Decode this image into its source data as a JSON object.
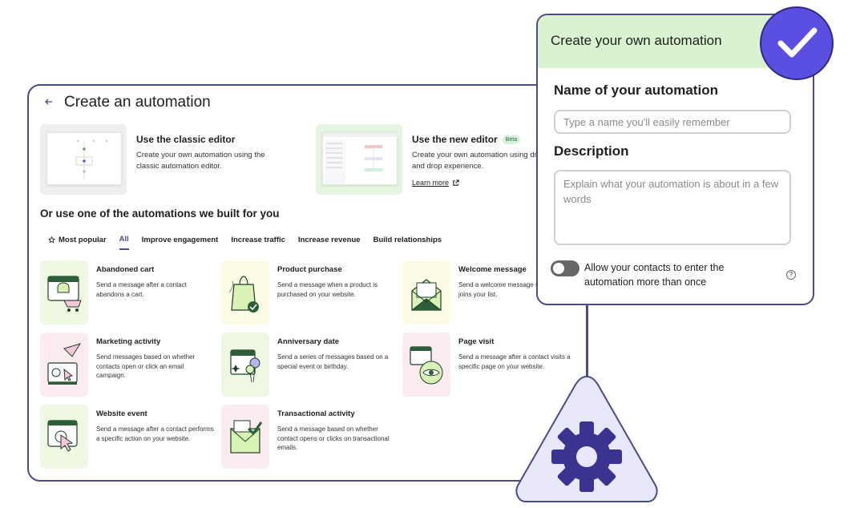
{
  "main": {
    "title": "Create an automation",
    "classic_editor": {
      "title": "Use the classic editor",
      "description": "Create your own automation using the classic automation editor."
    },
    "new_editor": {
      "title": "Use the new editor",
      "badge": "Beta",
      "description": "Create your own automation using drag and drop experience.",
      "learn_more": "Learn more"
    },
    "section_title": "Or use one of the automations we built for you",
    "tabs": [
      {
        "label": "Most popular"
      },
      {
        "label": "All"
      },
      {
        "label": "Improve engagement"
      },
      {
        "label": "Increase traffic"
      },
      {
        "label": "Increase revenue"
      },
      {
        "label": "Build relationships"
      }
    ],
    "active_tab": "All",
    "tiles": [
      {
        "title": "Abandoned cart",
        "description": "Send a message after a contact abandons a cart."
      },
      {
        "title": "Product purchase",
        "description": "Send a message when a product is purchased on your website."
      },
      {
        "title": "Welcome message",
        "description": "Send a welcome message subscriber joins your list."
      },
      {
        "title": "Marketing activity",
        "description": "Send messages based on whether contacts open or click an email campaign."
      },
      {
        "title": "Anniversary date",
        "description": "Send a series of messages based on a special event or birthday."
      },
      {
        "title": "Page visit",
        "description": "Send a message after a contact visits a specific page on your website."
      },
      {
        "title": "Website event",
        "description": "Send a message after a contact performs a specific action on your website."
      },
      {
        "title": "Transactional activity",
        "description": "Send a message based on whether contact opens or clicks on transactional emails."
      }
    ]
  },
  "form": {
    "header": "Create your own automation",
    "name_label": "Name of your automation",
    "name_placeholder": "Type a name you'll easily remember",
    "description_label": "Description",
    "description_placeholder": "Explain what your automation is about in a few words",
    "toggle_label": "Allow your contacts to enter the automation more than once",
    "toggle_on": false
  },
  "colors": {
    "accent": "#4a4a8c",
    "badge_purple": "#5a4fe0",
    "form_header_bg": "#daf2cf",
    "triangle_fill": "#e9e8fb",
    "gear": "#3a3490"
  },
  "icons": {
    "back": "arrow-left-icon",
    "most_popular": "star-icon",
    "external_link": "external-link-icon",
    "help": "question-circle-icon",
    "badge": "checkmark-icon",
    "gear": "gear-icon"
  }
}
